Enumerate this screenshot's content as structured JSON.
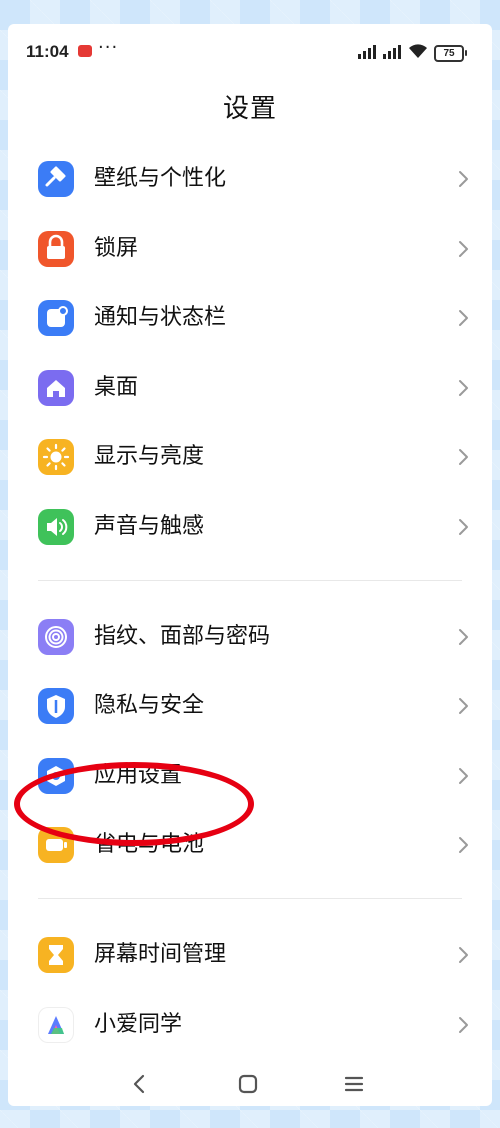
{
  "status_bar": {
    "time": "11:04",
    "dots": "···",
    "battery": "75"
  },
  "page": {
    "title": "设置"
  },
  "groups": [
    {
      "items": [
        {
          "label": "壁纸与个性化",
          "icon": "wallpaper-brush-icon",
          "color": "#3b7cf6"
        },
        {
          "label": "锁屏",
          "icon": "lock-icon",
          "color": "#f0562b"
        },
        {
          "label": "通知与状态栏",
          "icon": "notification-icon",
          "color": "#3b7cf6"
        },
        {
          "label": "桌面",
          "icon": "home-icon",
          "color": "#7b6cf0"
        },
        {
          "label": "显示与亮度",
          "icon": "sun-icon",
          "color": "#f7b322"
        },
        {
          "label": "声音与触感",
          "icon": "speaker-icon",
          "color": "#3fc25a"
        }
      ]
    },
    {
      "items": [
        {
          "label": "指纹、面部与密码",
          "icon": "fingerprint-icon",
          "color": "#8b7ef5"
        },
        {
          "label": "隐私与安全",
          "icon": "privacy-shield-icon",
          "color": "#3b7cf6"
        },
        {
          "label": "应用设置",
          "icon": "app-settings-icon",
          "color": "#3b7cf6"
        },
        {
          "label": "省电与电池",
          "icon": "battery-icon",
          "color": "#f7b322"
        }
      ]
    },
    {
      "items": [
        {
          "label": "屏幕时间管理",
          "icon": "hourglass-icon",
          "color": "#f7b322"
        },
        {
          "label": "小爱同学",
          "icon": "xiaoai-assistant-icon",
          "color": "#ffffff"
        }
      ]
    }
  ],
  "annotation": {
    "color": "#e60012",
    "target": "应用设置"
  }
}
